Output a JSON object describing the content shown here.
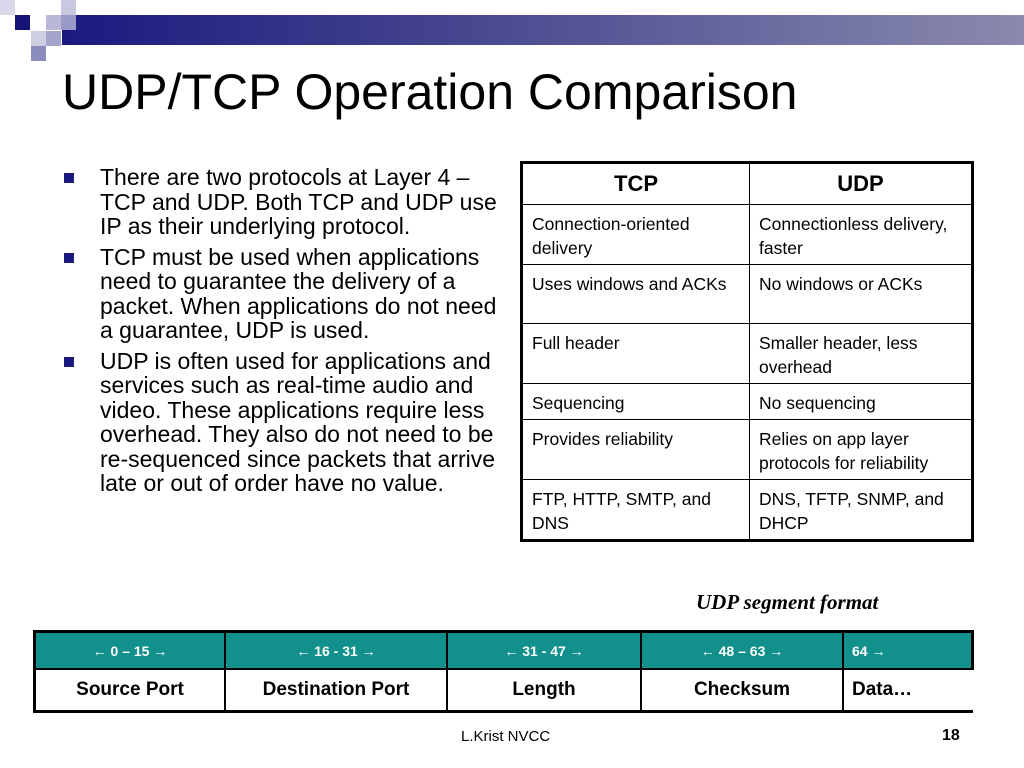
{
  "slide": {
    "title": "UDP/TCP Operation Comparison",
    "accent_color": "#1a1a80",
    "bullets": [
      "There are two protocols at Layer 4 – TCP and UDP. Both TCP and UDP use IP as their underlying protocol.",
      "TCP must be used when applications need to guarantee the delivery of a packet. When applications do not need a guarantee, UDP is used.",
      "UDP is often used for applications and services such as real-time audio and video. These applications require less overhead. They also do not need to be re-sequenced since packets that arrive late or out of order have no value."
    ],
    "comparison_table": {
      "headers": [
        "TCP",
        "UDP"
      ],
      "rows": [
        [
          "Connection-oriented delivery",
          "Connectionless delivery, faster"
        ],
        [
          "Uses windows and ACKs",
          "No windows or ACKs"
        ],
        [
          "Full header",
          "Smaller header, less overhead"
        ],
        [
          "Sequencing",
          "No sequencing"
        ],
        [
          "Provides reliability",
          "Relies on app layer protocols for reliability"
        ],
        [
          "FTP, HTTP, SMTP, and DNS",
          "DNS, TFTP, SNMP, and DHCP"
        ]
      ]
    },
    "segment_caption": "UDP segment format",
    "segment_format": {
      "header_color": "#11908c",
      "bit_ranges": [
        "←   0 – 15   →",
        "←   16 - 31   →",
        "←   31 - 47   →",
        "←   48 – 63   →",
        "64 →"
      ],
      "fields": [
        "Source Port",
        "Destination Port",
        "Length",
        "Checksum",
        "Data…"
      ]
    },
    "footer": "L.Krist NVCC",
    "page_number": "18"
  }
}
